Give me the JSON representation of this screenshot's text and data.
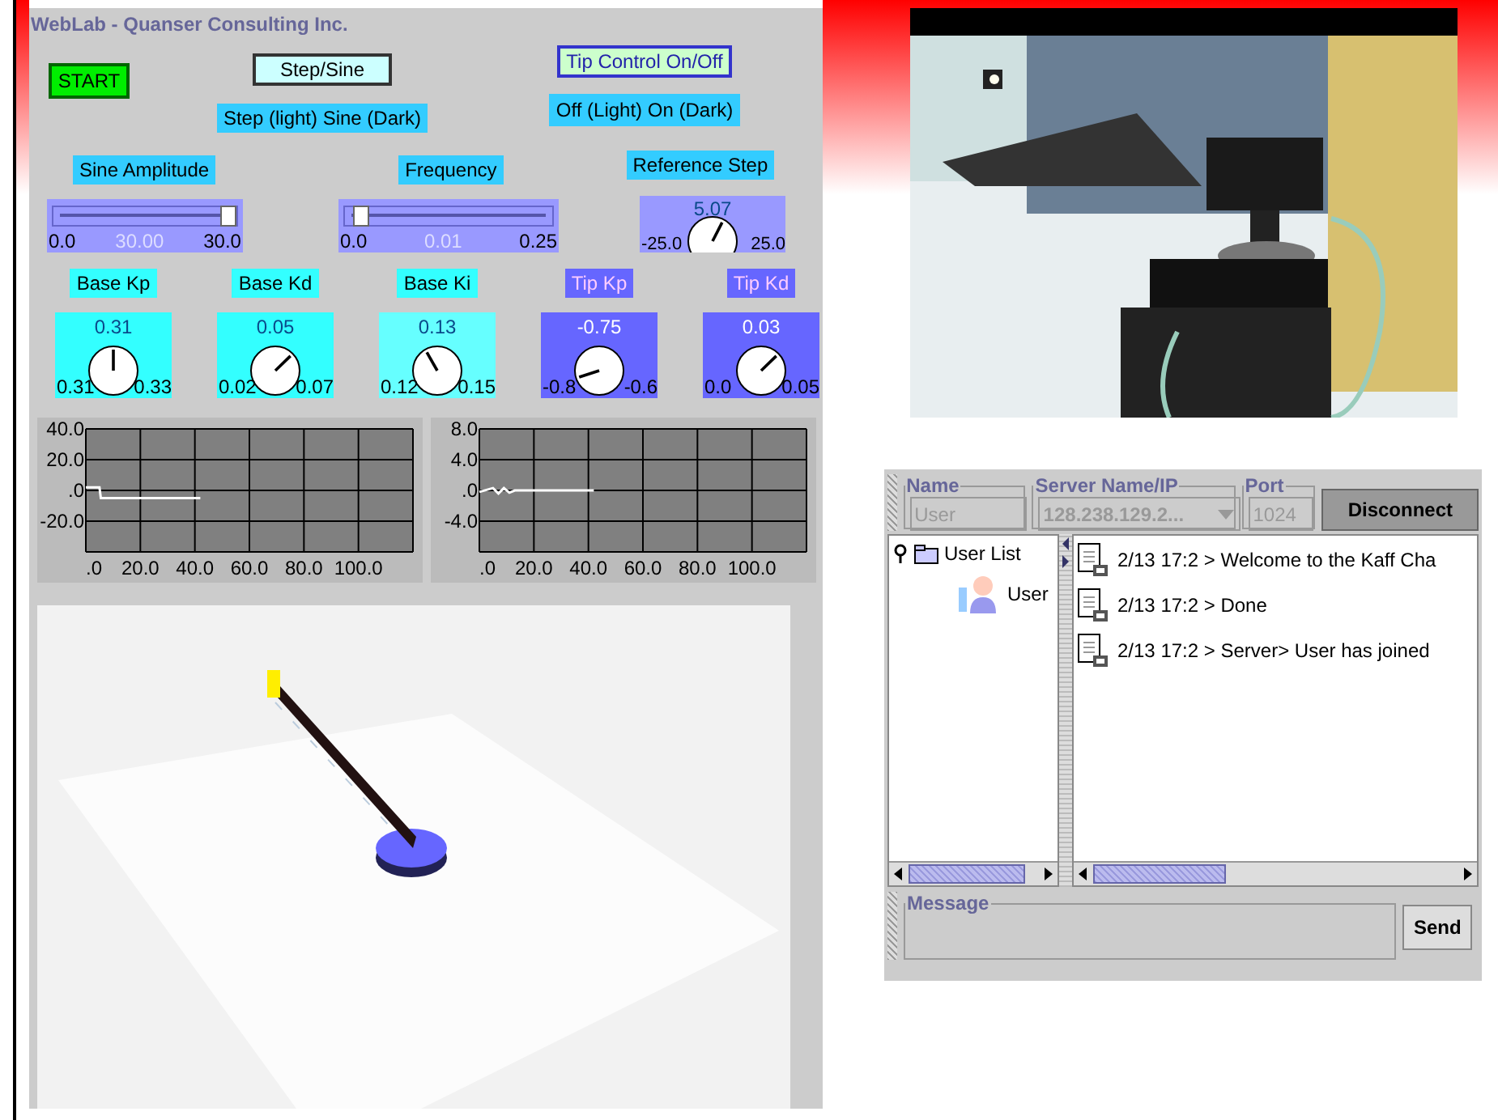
{
  "app_title": "WebLab - Quanser Consulting Inc.",
  "start_button": {
    "label": "START"
  },
  "mode_toggles": [
    {
      "button": "Step/Sine",
      "caption": "Step (light)  Sine (Dark)",
      "kind": "step",
      "on": false
    },
    {
      "button": "Tip Control On/Off",
      "caption": "Off (Light)  On (Dark)",
      "kind": "tip",
      "on": false
    }
  ],
  "sliders": [
    {
      "label": "Sine Amplitude",
      "min": "0.0",
      "value": "30.00",
      "max": "30.0",
      "level": 1
    },
    {
      "label": "Frequency",
      "min": "0.0",
      "value": "0.01",
      "max": "0.25",
      "level": 0.04
    }
  ],
  "reference_step": {
    "label": "Reference Step",
    "value": "5.07",
    "min": "-25.0",
    "max": "25.0",
    "level": 0.6
  },
  "gain_knobs": [
    {
      "label": "Base Kp",
      "value": "0.31",
      "min": "0.31",
      "max": "0.33",
      "level": 0.5,
      "kind": "base"
    },
    {
      "label": "Base Kd",
      "value": "0.05",
      "min": "0.02",
      "max": "0.07",
      "level": 0.67,
      "kind": "base"
    },
    {
      "label": "Base Ki",
      "value": "0.13",
      "min": "0.12",
      "max": "0.15",
      "level": 0.39,
      "kind": "base_light"
    },
    {
      "label": "Tip Kp",
      "value": "-0.75",
      "min": "-0.8",
      "max": "-0.6",
      "level": 0.1,
      "kind": "tip"
    },
    {
      "label": "Tip Kd",
      "value": "0.03",
      "min": "0.0",
      "max": "0.05",
      "level": 0.67,
      "kind": "tip"
    }
  ],
  "charts": [
    {
      "chart_data": {
        "type": "line",
        "x": [
          0,
          5,
          5.5,
          42
        ],
        "grid": true,
        "series": [
          {
            "color": "#ffffff",
            "values": [
              2,
              2,
              -5,
              -5
            ]
          }
        ],
        "xlim": [
          0,
          120
        ],
        "ylim": [
          -40,
          40
        ],
        "xticks": [
          {
            "value": 0,
            "label": ".0"
          },
          {
            "value": 20,
            "label": "20.0"
          },
          {
            "value": 40,
            "label": "40.0"
          },
          {
            "value": 60,
            "label": "60.0"
          },
          {
            "value": 80,
            "label": "80.0"
          },
          {
            "value": 100,
            "label": "100.0"
          }
        ],
        "yticks": [
          {
            "value": 40,
            "label": "40.0"
          },
          {
            "value": 20,
            "label": "20.0"
          },
          {
            "value": 0,
            "label": ".0"
          },
          {
            "value": -20,
            "label": "-20.0"
          }
        ]
      }
    },
    {
      "chart_data": {
        "type": "line",
        "x": [
          0,
          5,
          7,
          9,
          11,
          13,
          20,
          42
        ],
        "grid": true,
        "series": [
          {
            "color": "#ffffff",
            "values": [
              -0.2,
              0.3,
              -0.4,
              0.3,
              -0.3,
              0,
              0,
              0
            ]
          }
        ],
        "xlim": [
          0,
          120
        ],
        "ylim": [
          -8,
          8
        ],
        "xticks": [
          {
            "value": 0,
            "label": ".0"
          },
          {
            "value": 20,
            "label": "20.0"
          },
          {
            "value": 40,
            "label": "40.0"
          },
          {
            "value": 60,
            "label": "60.0"
          },
          {
            "value": 80,
            "label": "80.0"
          },
          {
            "value": 100,
            "label": "100.0"
          }
        ],
        "yticks": [
          {
            "value": 8,
            "label": "8.0"
          },
          {
            "value": 4,
            "label": "4.0"
          },
          {
            "value": 0,
            "label": ".0"
          },
          {
            "value": -4,
            "label": "-4.0"
          }
        ]
      }
    }
  ],
  "chat": {
    "fields": [
      {
        "label": "Name",
        "value": "User",
        "kind": "text",
        "disabled": true
      },
      {
        "label": "Server Name/IP",
        "value": "128.238.129.2...",
        "kind": "dropdown",
        "disabled": true
      },
      {
        "label": "Port",
        "value": "1024",
        "kind": "text",
        "disabled": true
      }
    ],
    "connect_button": "Disconnect",
    "user_tree": {
      "label": "User List",
      "expanded": true,
      "children": [
        {
          "label": "User"
        }
      ]
    },
    "messages": [
      "2/13 17:2 > Welcome to the Kaff Cha",
      "2/13 17:2 > Done",
      "2/13 17:2 > Server> User has joined"
    ],
    "message_field": {
      "label": "Message"
    },
    "send_button": "Send"
  }
}
